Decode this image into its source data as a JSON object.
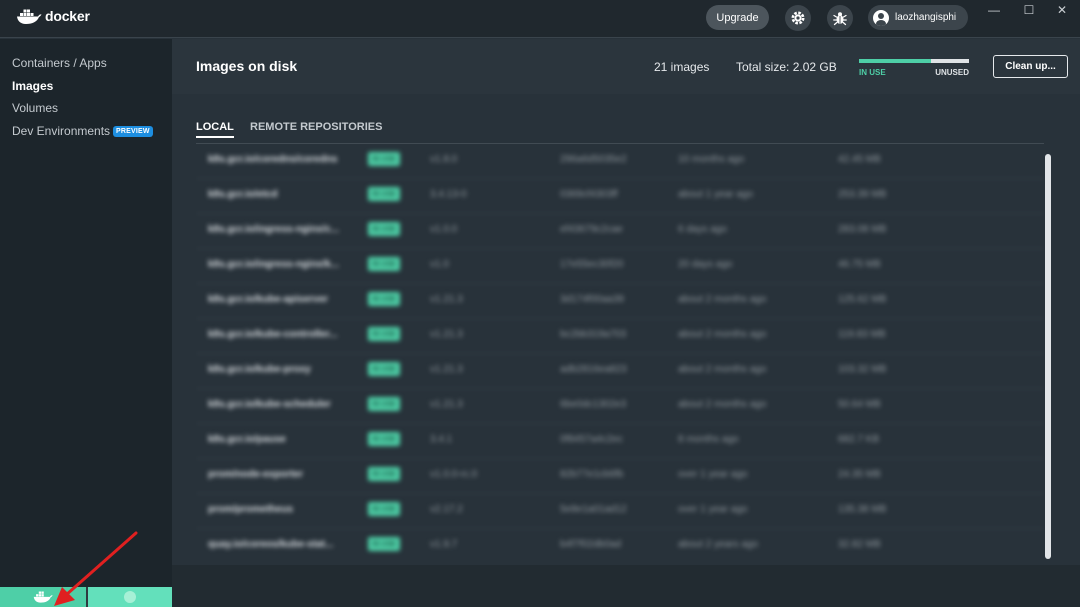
{
  "app": {
    "name": "docker"
  },
  "titlebar": {
    "upgrade_label": "Upgrade",
    "username": "laozhangisphi",
    "window_controls": [
      "—",
      "☐",
      "✕"
    ]
  },
  "sidebar": {
    "items": [
      {
        "label": "Containers / Apps"
      },
      {
        "label": "Images"
      },
      {
        "label": "Volumes"
      },
      {
        "label": "Dev Environments",
        "badge": "PREVIEW"
      }
    ]
  },
  "header": {
    "title": "Images on disk",
    "image_count": "21 images",
    "total_size": "Total size: 2.02 GB",
    "in_use_label": "IN USE",
    "unused_label": "UNUSED",
    "in_use_fraction": 0.65,
    "clean_label": "Clean up..."
  },
  "tabs": [
    {
      "label": "LOCAL"
    },
    {
      "label": "REMOTE REPOSITORIES"
    }
  ],
  "images": [
    {
      "name": "k8s.gcr.io/coredns/coredns",
      "status": "IN USE",
      "tag": "v1.8.0",
      "id": "296a6d5035e2",
      "created": "10 months ago",
      "size": "42.45 MB"
    },
    {
      "name": "k8s.gcr.io/etcd",
      "status": "IN USE",
      "tag": "3.4.13-0",
      "id": "0369cf4303ff",
      "created": "about 1 year ago",
      "size": "253.39 MB"
    },
    {
      "name": "k8s.gcr.io/ingress-nginx/c...",
      "status": "IN USE",
      "tag": "v1.0.0",
      "id": "ef43679c2cae",
      "created": "6 days ago",
      "size": "283.08 MB"
    },
    {
      "name": "k8s.gcr.io/ingress-nginx/k...",
      "status": "IN USE",
      "tag": "v1.0",
      "id": "17e55ec30f20",
      "created": "20 days ago",
      "size": "46.75 MB"
    },
    {
      "name": "k8s.gcr.io/kube-apiserver",
      "status": "IN USE",
      "tag": "v1.21.3",
      "id": "3d174f00aa39",
      "created": "about 2 months ago",
      "size": "125.62 MB"
    },
    {
      "name": "k8s.gcr.io/kube-controller...",
      "status": "IN USE",
      "tag": "v1.21.3",
      "id": "bc2bb319a703",
      "created": "about 2 months ago",
      "size": "119.83 MB"
    },
    {
      "name": "k8s.gcr.io/kube-proxy",
      "status": "IN USE",
      "tag": "v1.21.3",
      "id": "adb2816ea823",
      "created": "about 2 months ago",
      "size": "103.32 MB"
    },
    {
      "name": "k8s.gcr.io/kube-scheduler",
      "status": "IN USE",
      "tag": "v1.21.3",
      "id": "6be0dc1302e3",
      "created": "about 2 months ago",
      "size": "50.64 MB"
    },
    {
      "name": "k8s.gcr.io/pause",
      "status": "IN USE",
      "tag": "3.4.1",
      "id": "0f8457a4c2ec",
      "created": "8 months ago",
      "size": "682.7 KB"
    },
    {
      "name": "prom/node-exporter",
      "status": "IN USE",
      "tag": "v1.0.0-rc.0",
      "id": "82b77e1cb6fb",
      "created": "over 1 year ago",
      "size": "24.35 MB"
    },
    {
      "name": "prom/prometheus",
      "status": "IN USE",
      "tag": "v2.17.2",
      "id": "5e8e1a01ad12",
      "created": "over 1 year ago",
      "size": "135.38 MB"
    },
    {
      "name": "quay.io/coreos/kube-stat...",
      "status": "IN USE",
      "tag": "v1.9.7",
      "id": "b4f7f02db0ad",
      "created": "about 2 years ago",
      "size": "32.82 MB"
    }
  ],
  "colors": {
    "accent_green": "#4ecfa7",
    "preview_blue": "#1d8ee0",
    "annotation_red": "#e02020"
  }
}
